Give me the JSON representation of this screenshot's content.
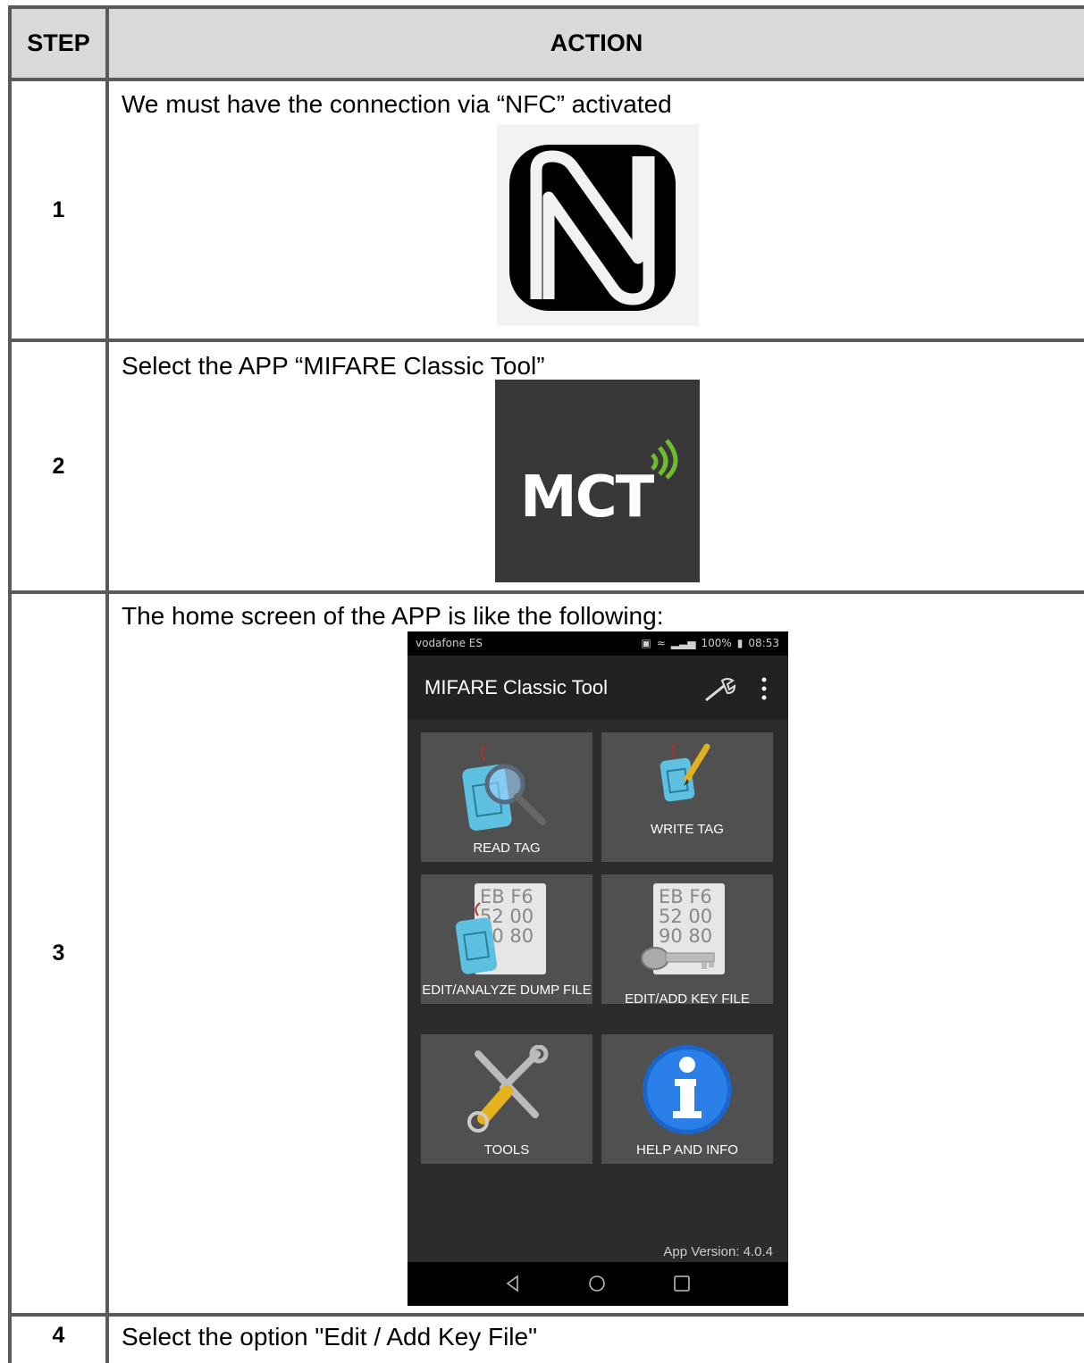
{
  "table": {
    "header": {
      "step": "STEP",
      "action": "ACTION"
    },
    "rows": [
      {
        "step": "1",
        "action": "We must have the connection via “NFC” activated"
      },
      {
        "step": "2",
        "action": "Select the APP “MIFARE Classic Tool”"
      },
      {
        "step": "3",
        "action": "The home screen of the APP is like the following:"
      },
      {
        "step": "4",
        "action": "Select the option \"Edit / Add Key File\""
      }
    ]
  },
  "mct_logo": {
    "text": "MCT"
  },
  "phone": {
    "status_bar": {
      "carrier": "vodafone ES",
      "battery": "100%",
      "time": "08:53"
    },
    "app_title": "MIFARE Classic Tool",
    "tiles": [
      {
        "label": "READ TAG"
      },
      {
        "label": "WRITE TAG"
      },
      {
        "label": "EDIT/ANALYZE DUMP FILE"
      },
      {
        "label": "EDIT/ADD KEY FILE"
      },
      {
        "label": "TOOLS"
      },
      {
        "label": "HELP AND INFO"
      }
    ],
    "dump_hex": [
      "EB F6",
      "52 00",
      "90 80"
    ],
    "version": "App Version: 4.0.4"
  },
  "colors": {
    "header_bg": "#d9d9d9",
    "border": "#5a5a5a",
    "app_bg": "#2c2c2c",
    "tile_bg": "#505050",
    "mct_green": "#6cbf2a"
  }
}
